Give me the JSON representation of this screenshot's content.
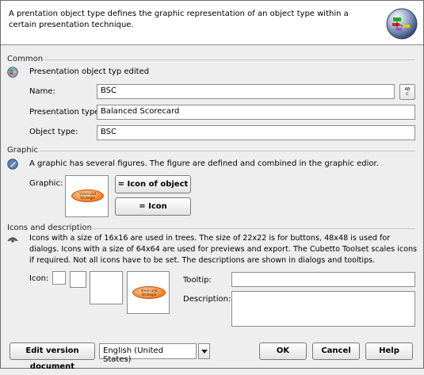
{
  "header": {
    "description": "A prentation object type defines the graphic representation of an object type within a certain presentation technique."
  },
  "common": {
    "title": "Common",
    "status": "Presentation object typ edited",
    "name_label": "Name:",
    "name_value": "BSC",
    "presentation_type_label": "Presentation type:",
    "presentation_type_value": "Balanced Scorecard",
    "object_type_label": "Object type:",
    "object_type_value": "BSC",
    "picker_button_text": "AB\nC"
  },
  "graphic": {
    "title": "Graphic",
    "info": "A graphic has several figures. The figure are defined and combined in the graphic edior.",
    "label": "Graphic:",
    "icon_of_object_type_button": "= Icon of object type",
    "icon_button": "= Icon",
    "preview_text": "Vision und Strategie"
  },
  "icons": {
    "title": "Icons and description",
    "info": "Icons with a size of 16x16 are used in trees. The size of 22x22 is for buttons, 48x48 is used for dialogs. Icons with a size of 64x64 are used for previews and export. The Cubetto Toolset scales icons if required. Not all icons have to be set. The descriptions are shown in dialogs and tooltips.",
    "icon_label": "Icon:",
    "tooltip_label": "Tooltip:",
    "tooltip_value": "",
    "description_label": "Description:",
    "description_value": "",
    "preview_text": "Vision und Strategie"
  },
  "footer": {
    "edit_version_button": "Edit version document",
    "language_value": "English (United States)",
    "ok_button": "OK",
    "cancel_button": "Cancel",
    "help_button": "Help"
  }
}
